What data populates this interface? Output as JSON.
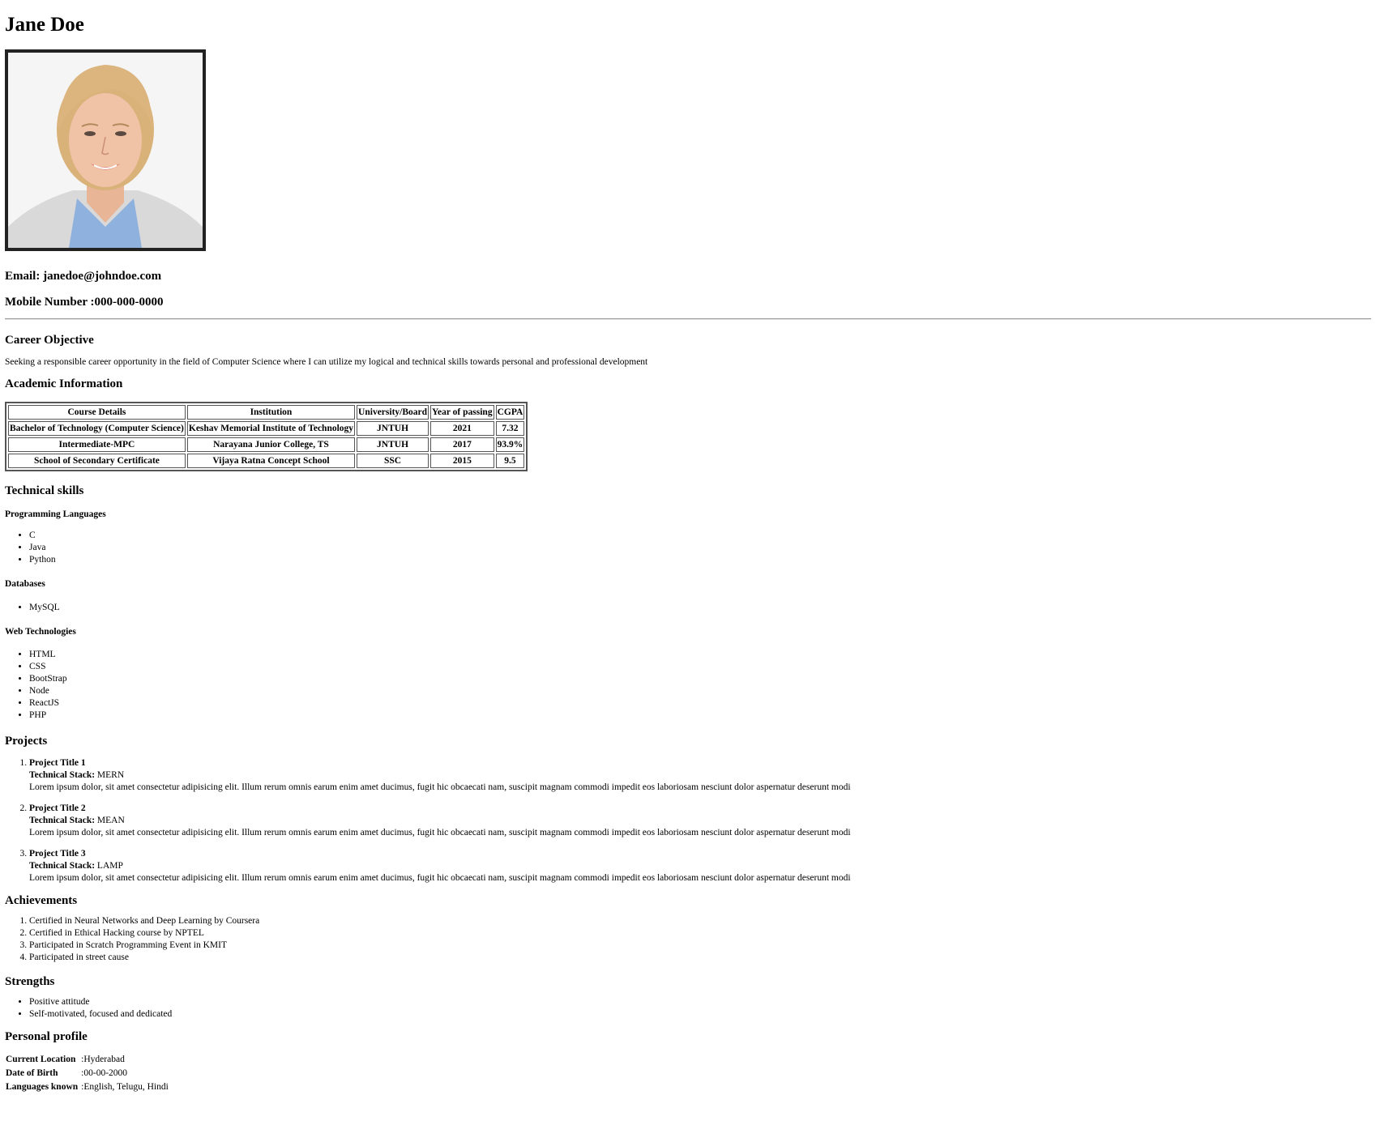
{
  "profile": {
    "name": "Jane Doe",
    "email_label": "Email:",
    "email": "janedoe@johndoe.com",
    "mobile_label": "Mobile Number :",
    "mobile": "000-000-0000"
  },
  "career_objective": {
    "heading": "Career Objective",
    "text": "Seeking a responsible career opportunity in the field of Computer Science where I can utilize my logical and technical skills towards personal and professional development"
  },
  "academic": {
    "heading": "Academic Information",
    "columns": [
      "Course Details",
      "Institution",
      "University/Board",
      "Year of passing",
      "CGPA"
    ],
    "rows": [
      [
        "Bachelor of Technology (Computer Science)",
        "Keshav Memorial Institute of Technology",
        "JNTUH",
        "2021",
        "7.32"
      ],
      [
        "Intermediate-MPC",
        "Narayana Junior College, TS",
        "JNTUH",
        "2017",
        "93.9%"
      ],
      [
        "School of Secondary Certificate",
        "Vijaya Ratna Concept School",
        "SSC",
        "2015",
        "9.5"
      ]
    ]
  },
  "technical_skills": {
    "heading": "Technical skills",
    "groups": [
      {
        "title": "Programming Languages",
        "items": [
          "C",
          "Java",
          "Python"
        ]
      },
      {
        "title": "Databases",
        "items": [
          "MySQL"
        ]
      },
      {
        "title": "Web Technologies",
        "items": [
          "HTML",
          "CSS",
          "BootStrap",
          "Node",
          "ReactJS",
          "PHP"
        ]
      }
    ]
  },
  "projects": {
    "heading": "Projects",
    "stack_label": "Technical Stack:",
    "items": [
      {
        "title": "Project Title 1",
        "stack": "MERN",
        "description": "Lorem ipsum dolor, sit amet consectetur adipisicing elit. Illum rerum omnis earum enim amet ducimus, fugit hic obcaecati nam, suscipit magnam commodi impedit eos laboriosam nesciunt dolor aspernatur deserunt modi"
      },
      {
        "title": "Project Title 2",
        "stack": "MEAN",
        "description": "Lorem ipsum dolor, sit amet consectetur adipisicing elit. Illum rerum omnis earum enim amet ducimus, fugit hic obcaecati nam, suscipit magnam commodi impedit eos laboriosam nesciunt dolor aspernatur deserunt modi"
      },
      {
        "title": "Project Title 3",
        "stack": "LAMP",
        "description": "Lorem ipsum dolor, sit amet consectetur adipisicing elit. Illum rerum omnis earum enim amet ducimus, fugit hic obcaecati nam, suscipit magnam commodi impedit eos laboriosam nesciunt dolor aspernatur deserunt modi"
      }
    ]
  },
  "achievements": {
    "heading": "Achievements",
    "items": [
      "Certified in Neural Networks and Deep Learning by Coursera",
      "Certified in Ethical Hacking course by NPTEL",
      "Participated in Scratch Programming Event in KMIT",
      "Participated in street cause"
    ]
  },
  "strengths": {
    "heading": "Strengths",
    "items": [
      "Positive attitude",
      "Self-motivated, focused and dedicated"
    ]
  },
  "personal_profile": {
    "heading": "Personal profile",
    "rows": [
      {
        "label": "Current Location",
        "value": ":Hyderabad"
      },
      {
        "label": "Date of Birth",
        "value": ":00-00-2000"
      },
      {
        "label": "Languages known",
        "value": ":English, Telugu, Hindi"
      }
    ]
  }
}
